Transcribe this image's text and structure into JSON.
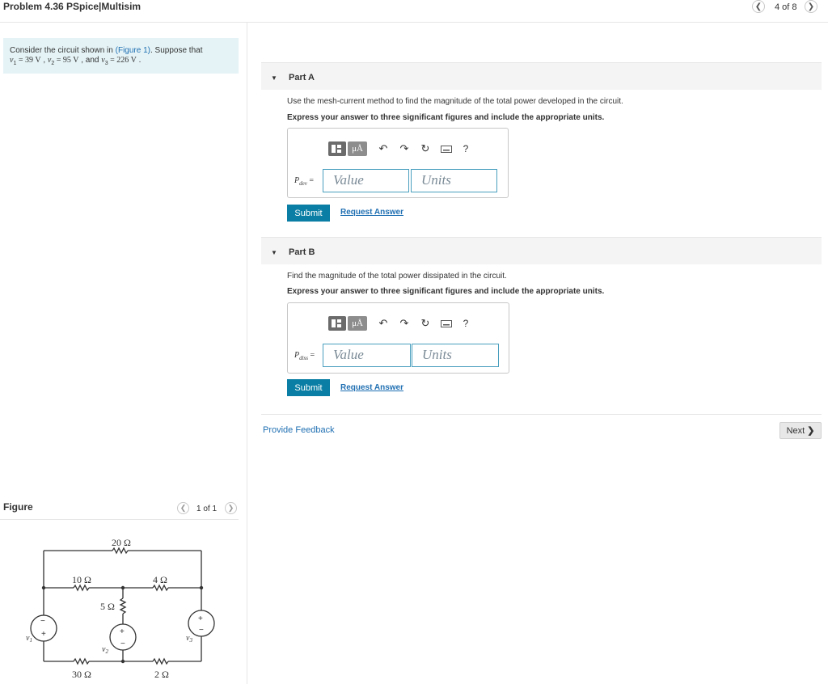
{
  "header": {
    "title": "Problem 4.36 PSpice|Multisim",
    "prev_icon": "chevron-left-icon",
    "next_icon": "chevron-right-icon",
    "counter": "4 of 8"
  },
  "intro": {
    "line1_pre": "Consider the circuit shown in ",
    "line1_link": "(Figure 1)",
    "line1_post": ". Suppose that",
    "v1_var": "v",
    "v1_sub": "1",
    "v1_val": " = 39  V",
    "sep1": " , ",
    "v2_var": "v",
    "v2_sub": "2",
    "v2_val": " = 95  V",
    "sep2": " , and ",
    "v3_var": "v",
    "v3_sub": "3",
    "v3_val": " = 226  V",
    "end": " ."
  },
  "partA": {
    "label": "Part A",
    "question": "Use the mesh-current method to find the magnitude of the total power developed in the circuit.",
    "instruction": "Express your answer to three significant figures and include the appropriate units.",
    "eq_label": "P",
    "eq_sub": "dev",
    "eq_sign": "=",
    "value_placeholder": "Value",
    "units_placeholder": "Units",
    "submit": "Submit",
    "request": "Request Answer"
  },
  "partB": {
    "label": "Part B",
    "question": "Find the magnitude of the total power dissipated in the circuit.",
    "instruction": "Express your answer to three significant figures and include the appropriate units.",
    "eq_label": "P",
    "eq_sub": "diss",
    "eq_sign": "=",
    "value_placeholder": "Value",
    "units_placeholder": "Units",
    "submit": "Submit",
    "request": "Request Answer"
  },
  "toolbar": {
    "templates_icon": "templates-icon",
    "mu_label": "μÅ",
    "undo_icon": "undo-icon",
    "redo_icon": "redo-icon",
    "reset_icon": "reset-icon",
    "keyboard_icon": "keyboard-icon",
    "help_label": "?"
  },
  "feedback": "Provide Feedback",
  "next_label": "Next",
  "figure": {
    "title": "Figure",
    "counter": "1 of 1",
    "circuit": {
      "r_top": "20 Ω",
      "r_left": "10 Ω",
      "r_right": "4 Ω",
      "r_mid": "5 Ω",
      "r_bottom_left": "30 Ω",
      "r_bottom_right": "2 Ω",
      "src_v1": "v",
      "src_v1_sub": "1",
      "src_v2": "v",
      "src_v2_sub": "2",
      "src_v3": "v",
      "src_v3_sub": "3"
    }
  },
  "colors": {
    "accent": "#0a7ea4",
    "link": "#1f6fb2",
    "intro_bg": "#e5f3f6",
    "field_border": "#4a9fbf"
  }
}
